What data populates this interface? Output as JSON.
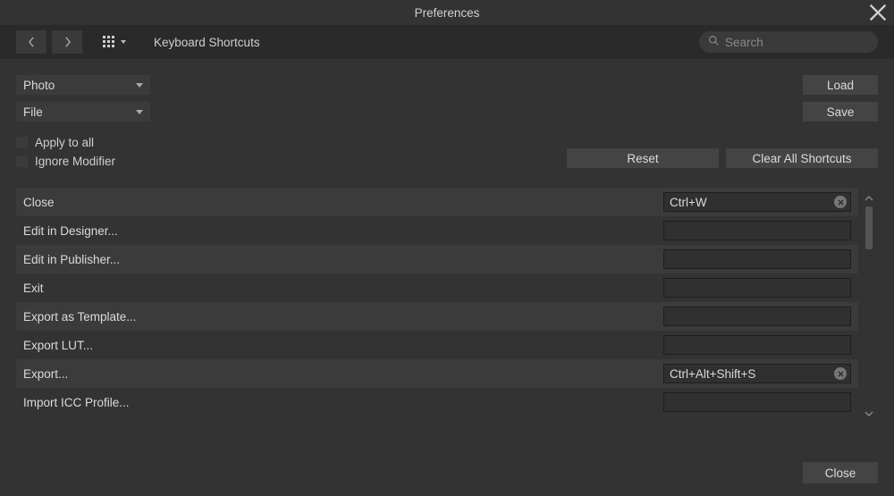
{
  "window": {
    "title": "Preferences"
  },
  "toolbar": {
    "section": "Keyboard Shortcuts",
    "search_placeholder": "Search"
  },
  "controls": {
    "persona_select": "Photo",
    "menu_select": "File",
    "load_label": "Load",
    "save_label": "Save",
    "apply_all_label": "Apply to all",
    "ignore_modifier_label": "Ignore Modifier",
    "reset_label": "Reset",
    "clear_all_label": "Clear All Shortcuts"
  },
  "rows": [
    {
      "label": "Close",
      "shortcut": "Ctrl+W",
      "has_clear": true
    },
    {
      "label": "Edit in Designer...",
      "shortcut": "",
      "has_clear": false
    },
    {
      "label": "Edit in Publisher...",
      "shortcut": "",
      "has_clear": false
    },
    {
      "label": "Exit",
      "shortcut": "",
      "has_clear": false
    },
    {
      "label": "Export as Template...",
      "shortcut": "",
      "has_clear": false
    },
    {
      "label": "Export LUT...",
      "shortcut": "",
      "has_clear": false
    },
    {
      "label": "Export...",
      "shortcut": "Ctrl+Alt+Shift+S",
      "has_clear": true
    },
    {
      "label": "Import ICC Profile...",
      "shortcut": "",
      "has_clear": false
    }
  ],
  "footer": {
    "close_label": "Close"
  }
}
